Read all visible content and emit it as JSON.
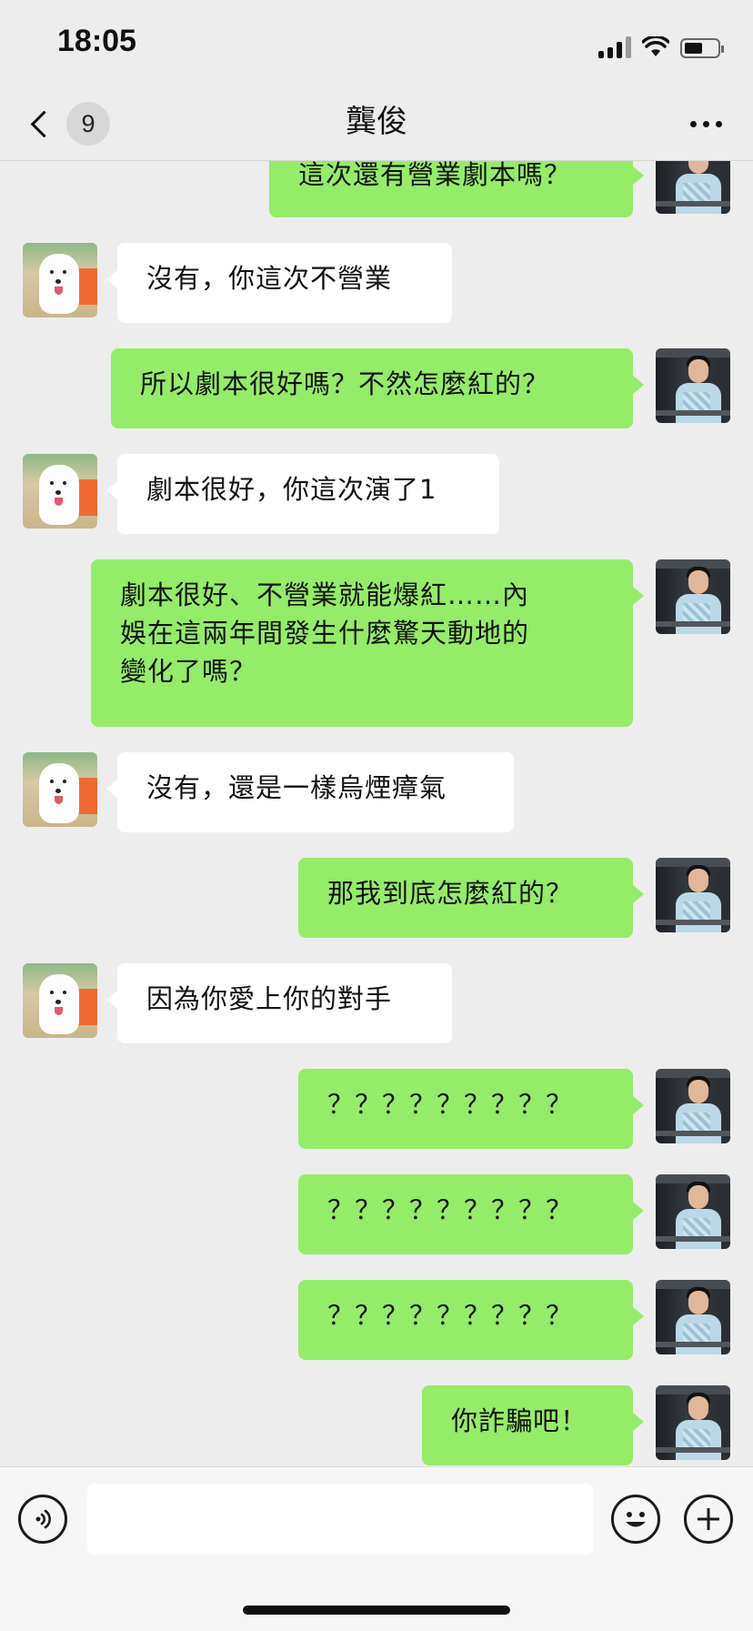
{
  "status_bar": {
    "time": "18:05"
  },
  "header": {
    "title": "龔俊",
    "unread_count": "9"
  },
  "messages": [
    {
      "side": "sent",
      "text": "這次還有營業劇本嗎？"
    },
    {
      "side": "received",
      "text": "沒有，你這次不營業"
    },
    {
      "side": "sent",
      "text": "所以劇本很好嗎？不然怎麼紅的？"
    },
    {
      "side": "received",
      "text": "劇本很好，你這次演了1"
    },
    {
      "side": "sent",
      "text": "劇本很好、不營業就能爆紅……內\n娛在這兩年間發生什麼驚天動地的\n變化了嗎？"
    },
    {
      "side": "received",
      "text": "沒有，還是一樣烏煙瘴氣"
    },
    {
      "side": "sent",
      "text": "那我到底怎麼紅的？"
    },
    {
      "side": "received",
      "text": "因為你愛上你的對手"
    },
    {
      "side": "sent",
      "text": "？？？？？？？？？"
    },
    {
      "side": "sent",
      "text": "？？？？？？？？？"
    },
    {
      "side": "sent",
      "text": "？？？？？？？？？"
    },
    {
      "side": "sent",
      "text": "你詐騙吧！"
    }
  ],
  "input": {
    "value": ""
  },
  "colors": {
    "background": "#ededed",
    "sent_bubble": "#95ec69",
    "received_bubble": "#ffffff"
  },
  "icons": {
    "back": "chevron-left-icon",
    "more": "more-horizontal-icon",
    "voice": "voice-icon",
    "emoji": "emoji-icon",
    "plus": "plus-icon"
  }
}
